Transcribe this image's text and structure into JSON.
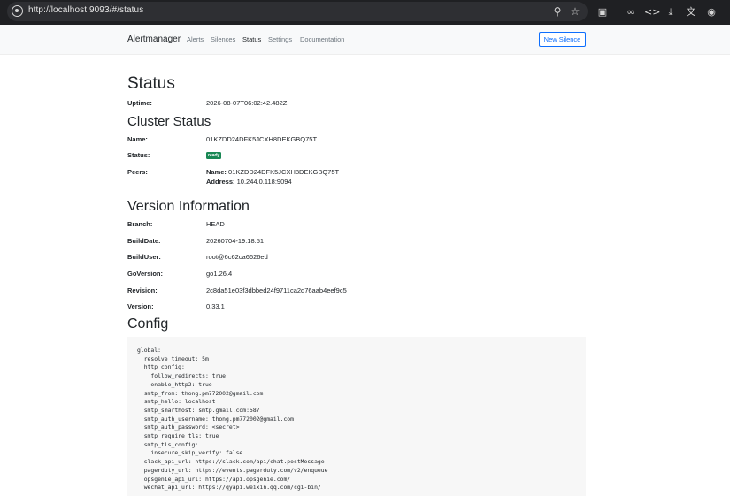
{
  "browser": {
    "url": "http://localhost:9093/#/status",
    "icons": [
      "site-info-icon",
      "zoom-icon",
      "star-icon",
      "extensions-icon",
      "link-icon",
      "code-icon",
      "download-icon",
      "translate-icon",
      "account-icon"
    ]
  },
  "navbar": {
    "brand": "Alertmanager",
    "links": [
      "Alerts",
      "Silences",
      "Status",
      "Settings",
      "Documentation"
    ],
    "active": "Status",
    "new_silence": "New Silence"
  },
  "status": {
    "title": "Status",
    "uptime_label": "Uptime:",
    "uptime_value": "2026-08-07T06:02:42.482Z"
  },
  "cluster": {
    "title": "Cluster Status",
    "name_label": "Name:",
    "name_value": "01KZDD24DFK5JCXH8DEKGBQ75T",
    "status_label": "Status:",
    "status_badge": "ready",
    "peers_label": "Peers:",
    "peer_name_label": "Name:",
    "peer_name_value": "01KZDD24DFK5JCXH8DEKGBQ75T",
    "peer_address_label": "Address:",
    "peer_address_value": "10.244.0.118:9094"
  },
  "version": {
    "title": "Version Information",
    "rows": [
      {
        "label": "Branch:",
        "value": "HEAD"
      },
      {
        "label": "BuildDate:",
        "value": "20260704-19:18:51"
      },
      {
        "label": "BuildUser:",
        "value": "root@6c62ca6626ed"
      },
      {
        "label": "GoVersion:",
        "value": "go1.26.4"
      },
      {
        "label": "Revision:",
        "value": "2c8da51e03f3dbbed24f9711ca2d76aab4eef9c5"
      },
      {
        "label": "Version:",
        "value": "0.33.1"
      }
    ]
  },
  "config": {
    "title": "Config",
    "text": "global:\n  resolve_timeout: 5m\n  http_config:\n    follow_redirects: true\n    enable_http2: true\n  smtp_from: thong.pm772002@gmail.com\n  smtp_hello: localhost\n  smtp_smarthost: smtp.gmail.com:587\n  smtp_auth_username: thong.pm772002@gmail.com\n  smtp_auth_password: <secret>\n  smtp_require_tls: true\n  smtp_tls_config:\n    insecure_skip_verify: false\n  slack_api_url: https://slack.com/api/chat.postMessage\n  pagerduty_url: https://events.pagerduty.com/v2/enqueue\n  opsgenie_api_url: https://api.opsgenie.com/\n  wechat_api_url: https://qyapi.weixin.qq.com/cgi-bin/"
  }
}
